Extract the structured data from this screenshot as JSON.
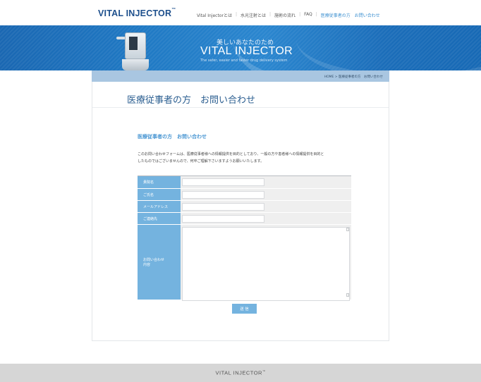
{
  "header": {
    "logo": "VITAL INJECTOR",
    "logo_tm": "™",
    "nav": [
      {
        "label": "Vital Injectorとは"
      },
      {
        "label": "水光注射とは"
      },
      {
        "label": "施術の流れ"
      },
      {
        "label": "FAQ"
      },
      {
        "label": "医療従事者の方　お問い合わせ"
      }
    ]
  },
  "banner": {
    "subtitle_jp": "美しいあなたのため",
    "title": "VITAL INJECTOR",
    "tagline": "The safer, easier and faster drug delivery system"
  },
  "breadcrumb": "HOME > 医療従事者の方　お問い合わせ",
  "page_title": "医療従事者の方　お問い合わせ",
  "section_title": "医療従事者の方　お問い合わせ",
  "intro_lines": [
    "このお問い合わせフォームは、医療従事者様への情報提供を目的としており、一般の方や患者様への情報提供を目的と",
    "したものではございませんので、何卒ご理解下さいますようお願いいたします。"
  ],
  "form": {
    "fields": [
      {
        "label": "貴院名",
        "value": ""
      },
      {
        "label": "ご氏名",
        "value": ""
      },
      {
        "label": "メールアドレス",
        "value": ""
      },
      {
        "label": "ご連絡先",
        "value": ""
      }
    ],
    "message_label_lines": [
      "お問い合わせ",
      "内容"
    ],
    "message_value": "",
    "submit_label": "送 信"
  },
  "footer": {
    "logo": "VITAL INJECTOR",
    "logo_tm": "™"
  },
  "colors": {
    "brand": "#1d4f8c",
    "accent": "#74b3df",
    "link_active": "#3b8fd0"
  }
}
